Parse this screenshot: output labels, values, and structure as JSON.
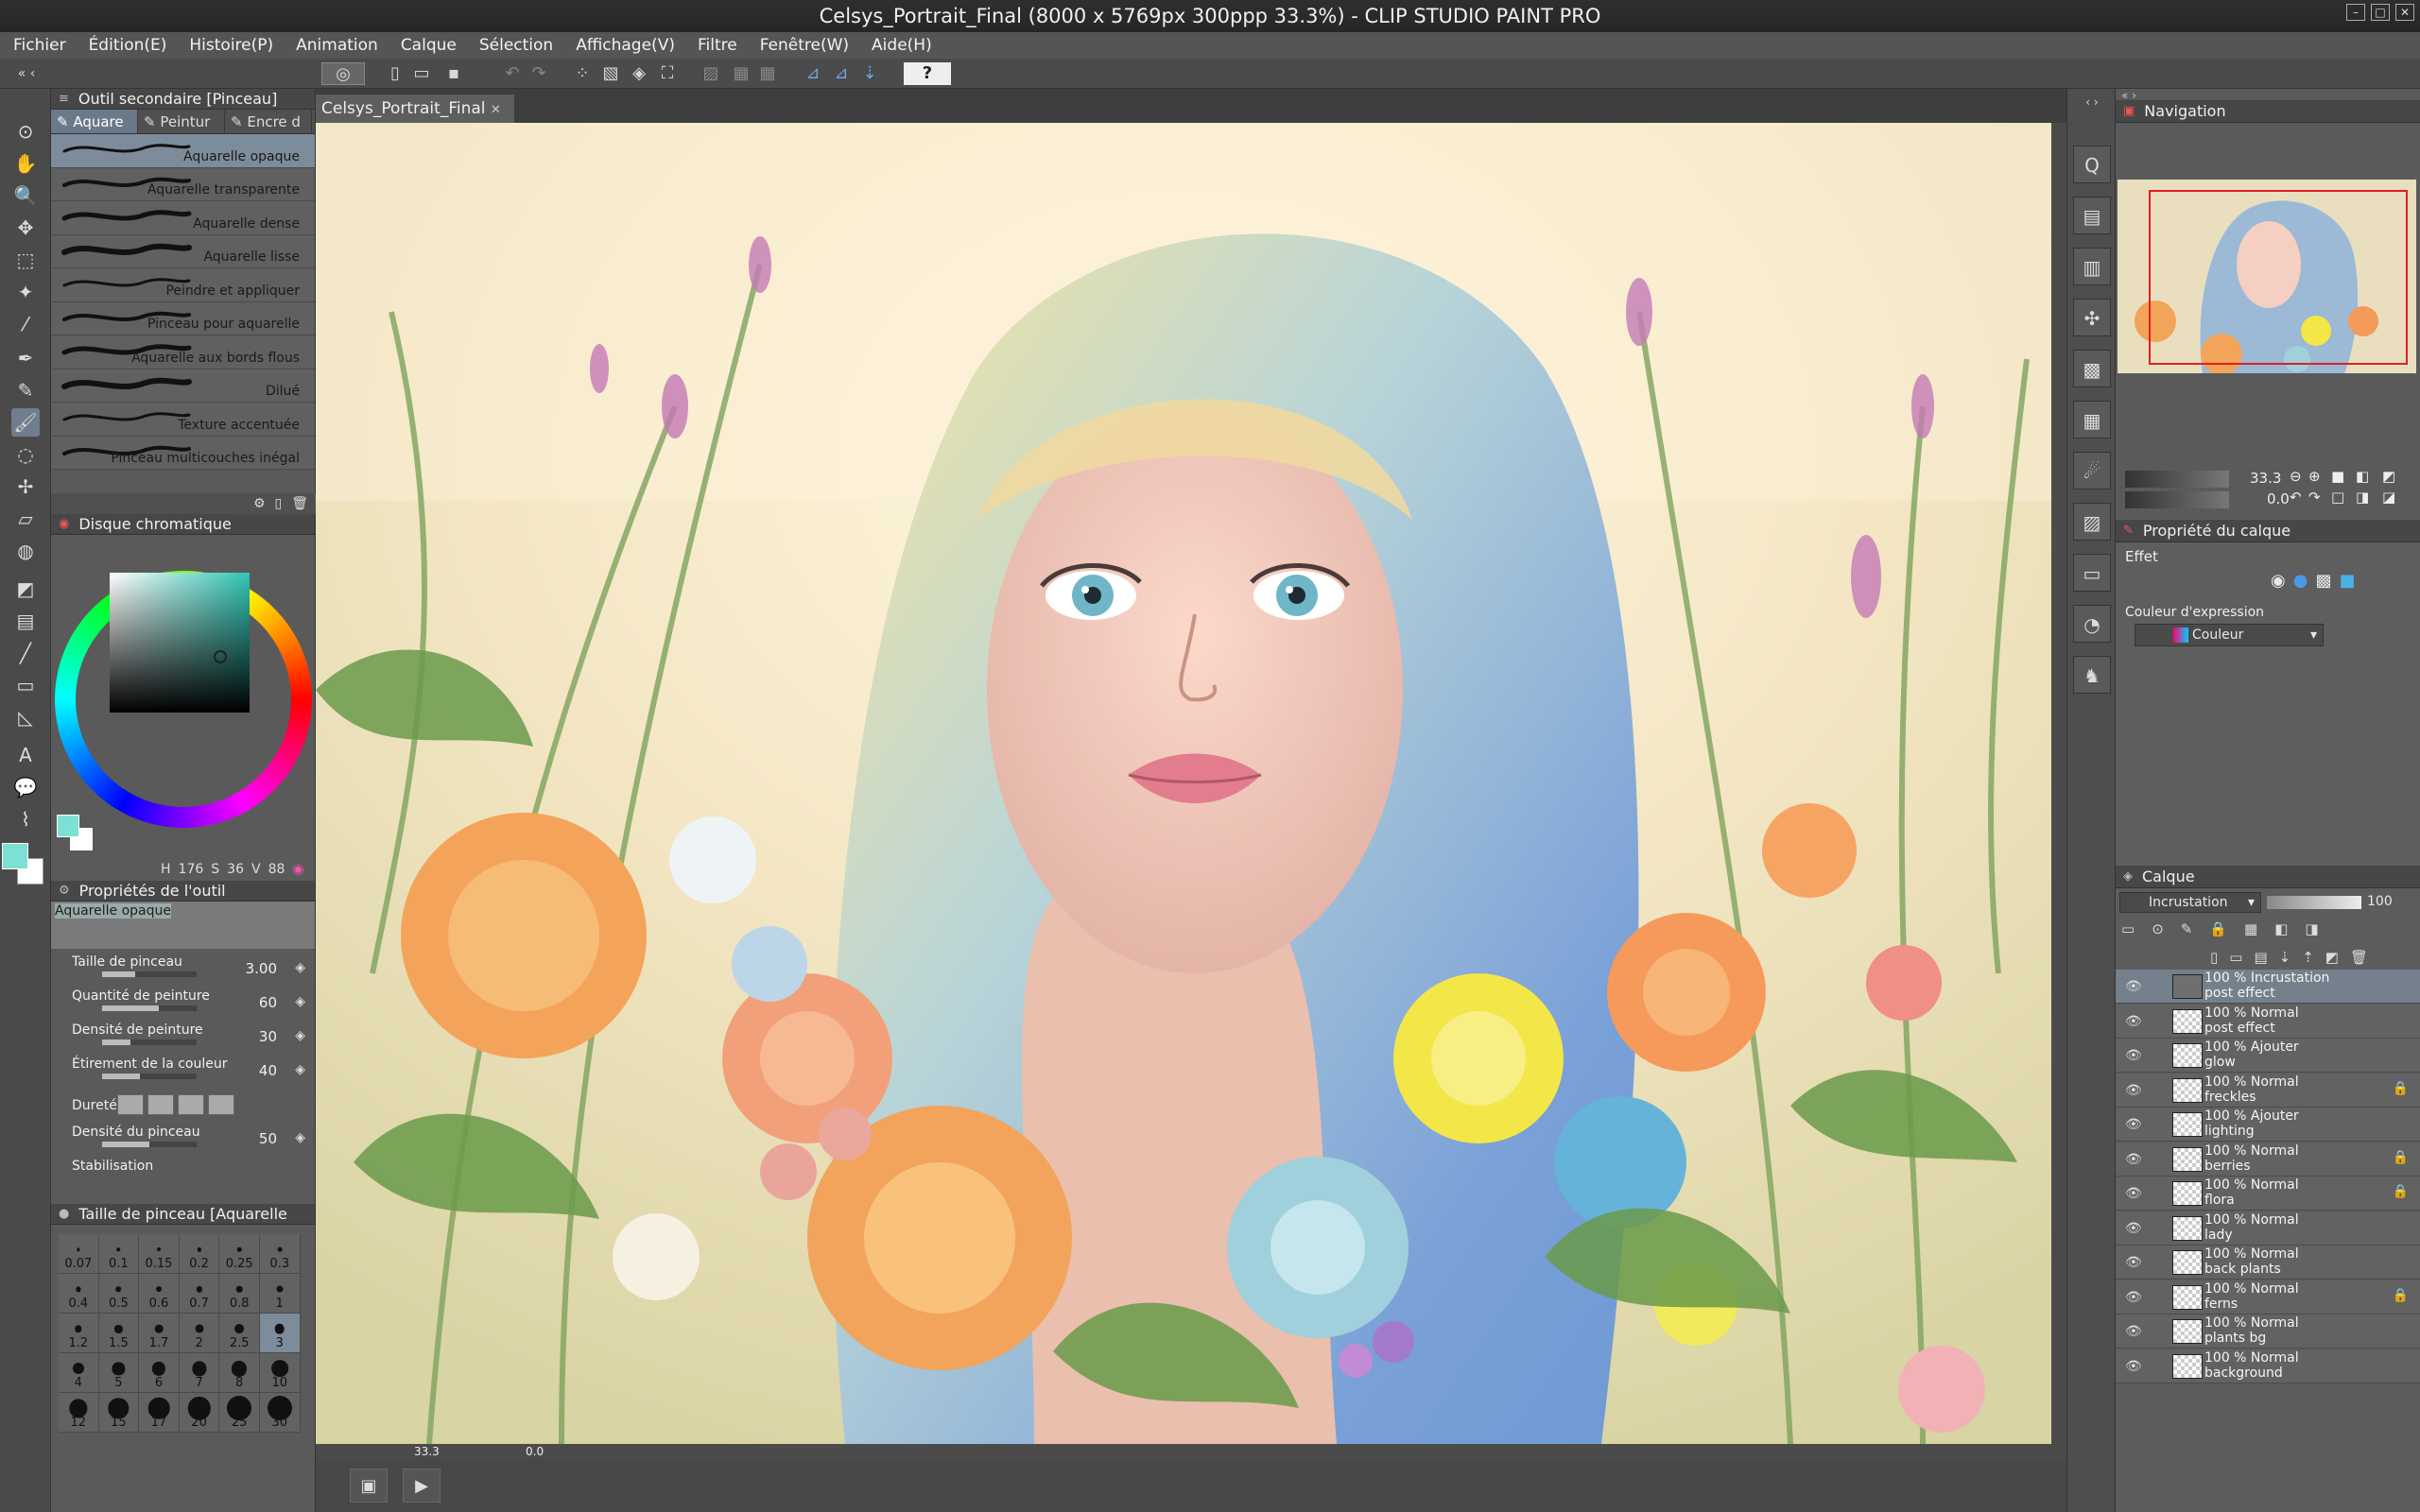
{
  "window": {
    "title": "Celsys_Portrait_Final (8000 x 5769px 300ppp 33.3%)  - CLIP STUDIO PAINT  PRO"
  },
  "menu": [
    "Fichier",
    "Édition(E)",
    "Histoire(P)",
    "Animation",
    "Calque",
    "Sélection",
    "Affichage(V)",
    "Filtre",
    "Fenêtre(W)",
    "Aide(H)"
  ],
  "subtool": {
    "title": "Outil secondaire [Pinceau]",
    "tabs": [
      "Aquare",
      "Peintur",
      "Encre d"
    ],
    "brushes": [
      "Aquarelle opaque",
      "Aquarelle transparente",
      "Aquarelle dense",
      "Aquarelle lisse",
      "Peindre et appliquer",
      "Pinceau pour aquarelle",
      "Aquarelle aux bords flous",
      "Dilué",
      "Texture accentuée",
      "Pinceau multicouches inégal"
    ]
  },
  "color": {
    "title": "Disque chromatique",
    "h": "176",
    "s": "36",
    "v": "88",
    "main": "#7de0d4",
    "sub": "#ffffff"
  },
  "toolprop": {
    "title": "Propriétés de l'outil",
    "preset": "Aquarelle opaque",
    "props": [
      {
        "label": "Taille de pinceau",
        "value": "3.00",
        "level": 0.35
      },
      {
        "label": "Quantité de peinture",
        "value": "60",
        "level": 0.6
      },
      {
        "label": "Densité de peinture",
        "value": "30",
        "level": 0.3
      },
      {
        "label": "Étirement de la couleur",
        "value": "40",
        "level": 0.4
      },
      {
        "label": "Dureté",
        "value": "",
        "level": 0
      },
      {
        "label": "Densité du pinceau",
        "value": "50",
        "level": 0.5
      },
      {
        "label": "Stabilisation",
        "value": "",
        "level": 0
      }
    ]
  },
  "brushsize": {
    "title": "Taille de pinceau [Aquarelle",
    "sizes": [
      "0.07",
      "0.1",
      "0.15",
      "0.2",
      "0.25",
      "0.3",
      "0.4",
      "0.5",
      "0.6",
      "0.7",
      "0.8",
      "1",
      "1.2",
      "1.5",
      "1.7",
      "2",
      "2.5",
      "3",
      "4",
      "5",
      "6",
      "7",
      "8",
      "10",
      "12",
      "15",
      "17",
      "20",
      "25",
      "30"
    ],
    "selected": "3"
  },
  "canvas": {
    "tab": "Celsys_Portrait_Final",
    "zoom": "33.3",
    "angle": "0.0"
  },
  "navigation": {
    "title": "Navigation",
    "zoom": "33.3",
    "angle": "0.0"
  },
  "layerprop": {
    "title": "Propriété du calque",
    "effect": "Effet",
    "expr_label": "Couleur d'expression",
    "expr_value": "Couleur"
  },
  "layers": {
    "title": "Calque",
    "blend": "Incrustation",
    "opacity": "100",
    "items": [
      {
        "l1": "100 % Incrustation",
        "l2": "post effect",
        "lock": false
      },
      {
        "l1": "100 % Normal",
        "l2": "post effect",
        "lock": false
      },
      {
        "l1": "100 % Ajouter",
        "l2": "glow",
        "lock": false
      },
      {
        "l1": "100 % Normal",
        "l2": "freckles",
        "lock": true
      },
      {
        "l1": "100 % Ajouter",
        "l2": "lighting",
        "lock": false
      },
      {
        "l1": "100 % Normal",
        "l2": "berries",
        "lock": true
      },
      {
        "l1": "100 % Normal",
        "l2": "flora",
        "lock": true
      },
      {
        "l1": "100 % Normal",
        "l2": "lady",
        "lock": false
      },
      {
        "l1": "100 % Normal",
        "l2": "back plants",
        "lock": false
      },
      {
        "l1": "100 % Normal",
        "l2": "ferns",
        "lock": true
      },
      {
        "l1": "100 % Normal",
        "l2": "plants bg",
        "lock": false
      },
      {
        "l1": "100 % Normal",
        "l2": "background",
        "lock": false
      }
    ]
  }
}
